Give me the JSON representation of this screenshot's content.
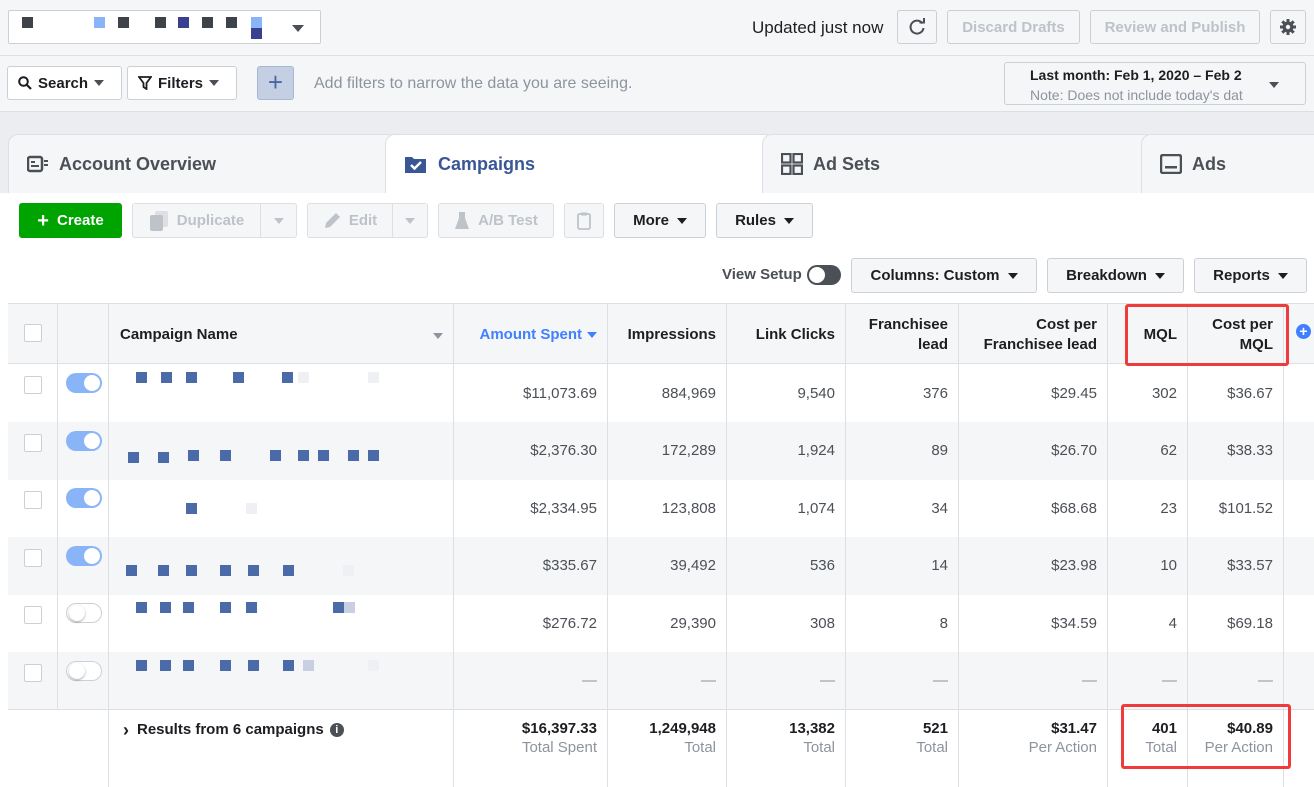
{
  "topbar": {
    "updated": "Updated just now",
    "discard": "Discard Drafts",
    "review": "Review and Publish"
  },
  "filterbar": {
    "search": "Search",
    "filters": "Filters",
    "hint": "Add filters to narrow the data you are seeing.",
    "date_line1": "Last month: Feb 1, 2020 – Feb 2",
    "date_line2": "Note: Does not include today's dat"
  },
  "tabs": {
    "account": "Account Overview",
    "campaigns": "Campaigns",
    "adsets": "Ad Sets",
    "ads": "Ads"
  },
  "toolbar": {
    "create": "Create",
    "duplicate": "Duplicate",
    "edit": "Edit",
    "abtest": "A/B Test",
    "more": "More",
    "rules": "Rules",
    "view_setup": "View Setup",
    "columns_label": "Columns:",
    "columns_value": "Custom",
    "breakdown": "Breakdown",
    "reports": "Reports"
  },
  "columns": {
    "name": "Campaign Name",
    "amount": "Amount Spent",
    "impressions": "Impressions",
    "clicks": "Link Clicks",
    "franchisee_1": "Franchisee",
    "franchisee_2": "lead",
    "cpfl_1": "Cost per",
    "cpfl_2": "Franchisee lead",
    "mql": "MQL",
    "cpmql_1": "Cost per",
    "cpmql_2": "MQL"
  },
  "rows": [
    {
      "on": true,
      "amount": "$11,073.69",
      "impressions": "884,969",
      "clicks": "9,540",
      "franchisee": "376",
      "cpfl": "$29.45",
      "mql": "302",
      "cpmql": "$36.67"
    },
    {
      "on": true,
      "amount": "$2,376.30",
      "impressions": "172,289",
      "clicks": "1,924",
      "franchisee": "89",
      "cpfl": "$26.70",
      "mql": "62",
      "cpmql": "$38.33"
    },
    {
      "on": true,
      "amount": "$2,334.95",
      "impressions": "123,808",
      "clicks": "1,074",
      "franchisee": "34",
      "cpfl": "$68.68",
      "mql": "23",
      "cpmql": "$101.52"
    },
    {
      "on": true,
      "amount": "$335.67",
      "impressions": "39,492",
      "clicks": "536",
      "franchisee": "14",
      "cpfl": "$23.98",
      "mql": "10",
      "cpmql": "$33.57"
    },
    {
      "on": false,
      "amount": "$276.72",
      "impressions": "29,390",
      "clicks": "308",
      "franchisee": "8",
      "cpfl": "$34.59",
      "mql": "4",
      "cpmql": "$69.18"
    },
    {
      "on": false,
      "amount": "—",
      "impressions": "—",
      "clicks": "—",
      "franchisee": "—",
      "cpfl": "—",
      "mql": "—",
      "cpmql": "—"
    }
  ],
  "totals": {
    "label": "Results from 6 campaigns",
    "amount": "$16,397.33",
    "amount_sub": "Total Spent",
    "impressions": "1,249,948",
    "impressions_sub": "Total",
    "clicks": "13,382",
    "clicks_sub": "Total",
    "franchisee": "521",
    "franchisee_sub": "Total",
    "cpfl": "$31.47",
    "cpfl_sub": "Per Action",
    "mql": "401",
    "mql_sub": "Total",
    "cpmql": "$40.89",
    "cpmql_sub": "Per Action"
  },
  "colors": {
    "accent": "#4080ff",
    "create_green": "#00a400",
    "highlight_red": "#ef3b3b"
  }
}
